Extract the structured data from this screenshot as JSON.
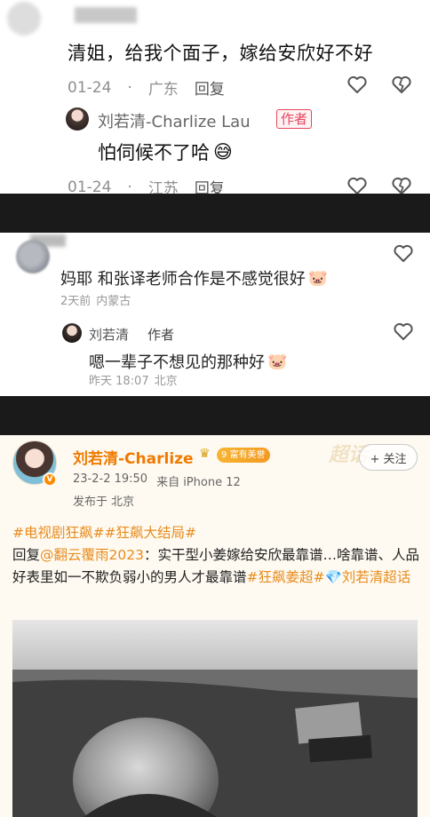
{
  "panel1": {
    "comment": "清姐，给我个面子，嫁给安欣好不好",
    "comment_meta": {
      "date": "01-24",
      "location": "广东",
      "reply": "回复"
    },
    "reply": {
      "name": "刘若清-Charlize Lau",
      "badge": "作者",
      "text": "怕伺候不了哈",
      "emoji": "😅"
    },
    "reply_meta": {
      "date": "01-24",
      "location": "江苏",
      "reply": "回复"
    }
  },
  "panel2": {
    "comment": "妈耶 和张译老师合作是不感觉很好",
    "comment_emoji": "🐷",
    "comment_meta": {
      "time": "2天前",
      "location": "内蒙古"
    },
    "reply": {
      "name": "刘若清",
      "badge": "作者",
      "text": "嗯一辈子不想见的那种好",
      "emoji": "🐷"
    },
    "reply_meta": {
      "time": "昨天 18:07",
      "location": "北京"
    }
  },
  "panel3": {
    "name": "刘若清-Charlize",
    "level_badge": "9 富有美誉",
    "watermark": "超话",
    "follow_label": "+ 关注",
    "time": "23-2-2 19:50",
    "device": "来自 iPhone 12",
    "location": "发布于 北京",
    "tags_line": "#电视剧狂飙##狂飙大结局#",
    "reply_prefix": "回复",
    "mention": "@翻云覆雨2023",
    "body_part1": "：实干型小姜嫁给安欣最靠谱…啥靠谱、人品好表里如一不欺负弱小的男人才最靠谱",
    "tag_inline": "#狂飙姜超#",
    "supertopic": "💎刘若清超话"
  },
  "colors": {
    "accent_orange": "#e78b1d",
    "author_red": "#e7455d",
    "name_orange": "#f07a00"
  }
}
